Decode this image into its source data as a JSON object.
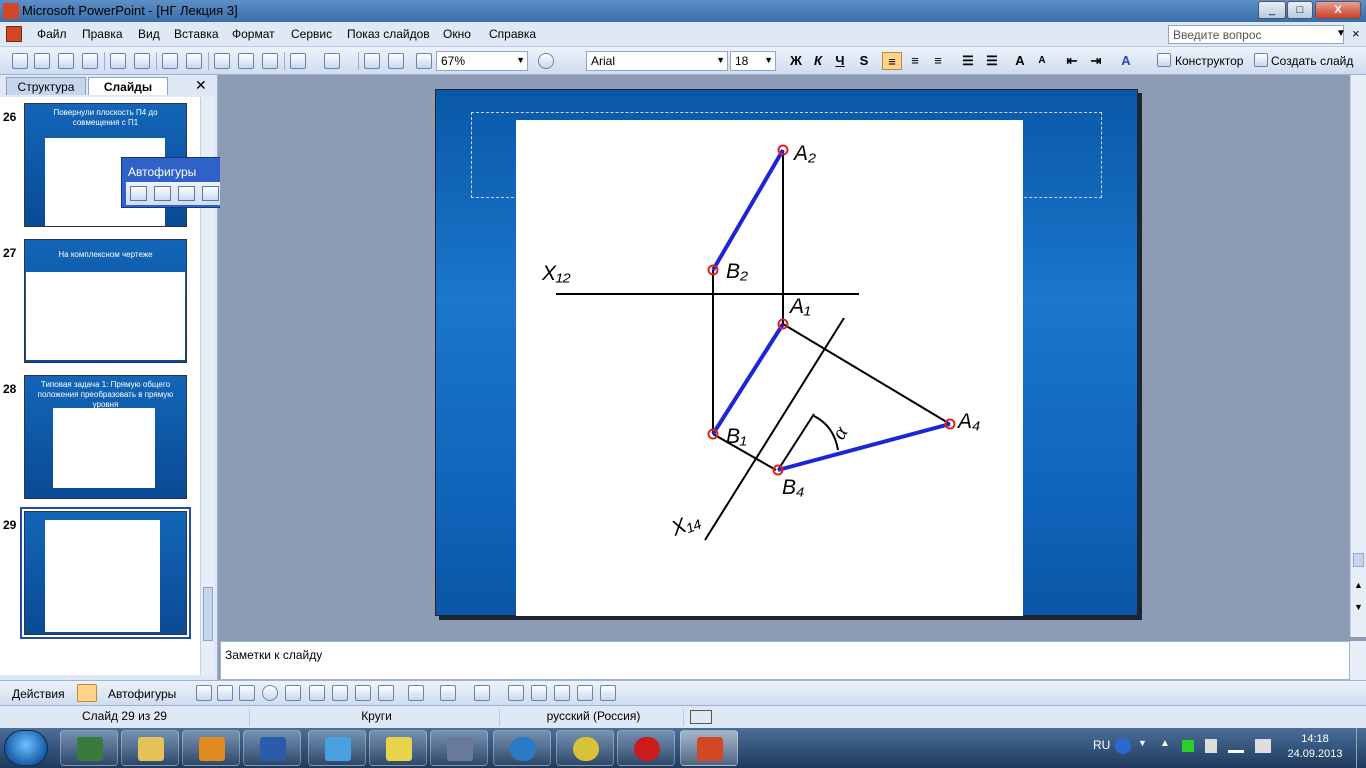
{
  "window": {
    "title": "Microsoft PowerPoint - [НГ Лекция 3]",
    "min": "_",
    "max": "□",
    "close": "X"
  },
  "menu": {
    "items": [
      "Файл",
      "Правка",
      "Вид",
      "Вставка",
      "Формат",
      "Сервис",
      "Показ слайдов",
      "Окно",
      "Справка"
    ],
    "help_placeholder": "Введите вопрос",
    "close": "×"
  },
  "toolbar": {
    "zoom": "67%",
    "font": "Arial",
    "size": "18",
    "bold": "Ж",
    "italic": "К",
    "underline": "Ч",
    "shadow": "S",
    "designer": "Конструктор",
    "new_slide": "Создать слайд"
  },
  "pane": {
    "tabs": [
      "Структура",
      "Слайды"
    ],
    "close": "✕",
    "slides": [
      {
        "num": "26",
        "title": "Повернули плоскость П4 до совмещения с П1"
      },
      {
        "num": "27",
        "title": "На комплексном чертеже"
      },
      {
        "num": "28",
        "title": "Типовая задача 1: Прямую общего положения преобразовать в прямую уровня"
      },
      {
        "num": "29",
        "title": ""
      }
    ]
  },
  "autoshapes_toolbar": {
    "title": "Автофигуры",
    "menu": "▼",
    "close": "✕"
  },
  "slide_labels": {
    "A2": "A₂",
    "B2": "B₂",
    "X12": "X₁₂",
    "A1": "A₁",
    "B1": "B₁",
    "A4": "A₄",
    "B4": "B₄",
    "X14": "X₁₄",
    "alpha": "α"
  },
  "notes": {
    "placeholder": "Заметки к слайду"
  },
  "drawbar": {
    "actions": "Действия",
    "autoshapes": "Автофигуры"
  },
  "status": {
    "slide": "Слайд 29 из 29",
    "design": "Круги",
    "lang": "русский (Россия)"
  },
  "taskbar": {
    "lang": "RU",
    "time": "14:18",
    "date": "24.09.2013"
  },
  "colors": {
    "accent": "#1f4fa5",
    "slide_bg": "#0e63b8",
    "segment": "#1b27d6",
    "point": "#e02020"
  }
}
